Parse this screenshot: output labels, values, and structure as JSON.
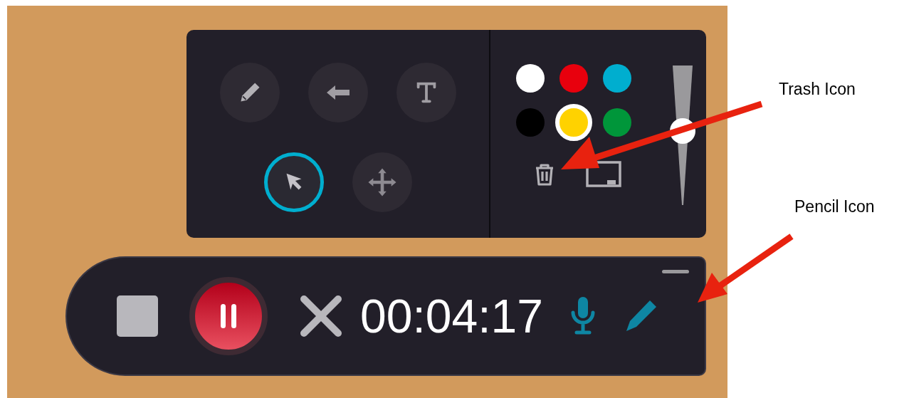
{
  "tool_rows": [
    [
      {
        "kind": "pencil",
        "selected": false
      },
      {
        "kind": "arrow",
        "selected": false
      },
      {
        "kind": "text",
        "selected": false
      }
    ],
    [
      {
        "kind": "select",
        "selected": true
      },
      {
        "kind": "move",
        "selected": false
      }
    ]
  ],
  "colors": [
    {
      "color": "#ffffff",
      "selected": false
    },
    {
      "color": "#e8000d",
      "selected": false
    },
    {
      "color": "#00aecf",
      "selected": false
    },
    {
      "color": "#000000",
      "selected": false
    },
    {
      "color": "#ffd200",
      "selected": true
    },
    {
      "color": "#00963a",
      "selected": false
    }
  ],
  "size_slider": {
    "level": 0.53
  },
  "timer": "00:04:17",
  "annotations": [
    {
      "label": "Trash Icon"
    },
    {
      "label": "Pencil Icon"
    }
  ]
}
